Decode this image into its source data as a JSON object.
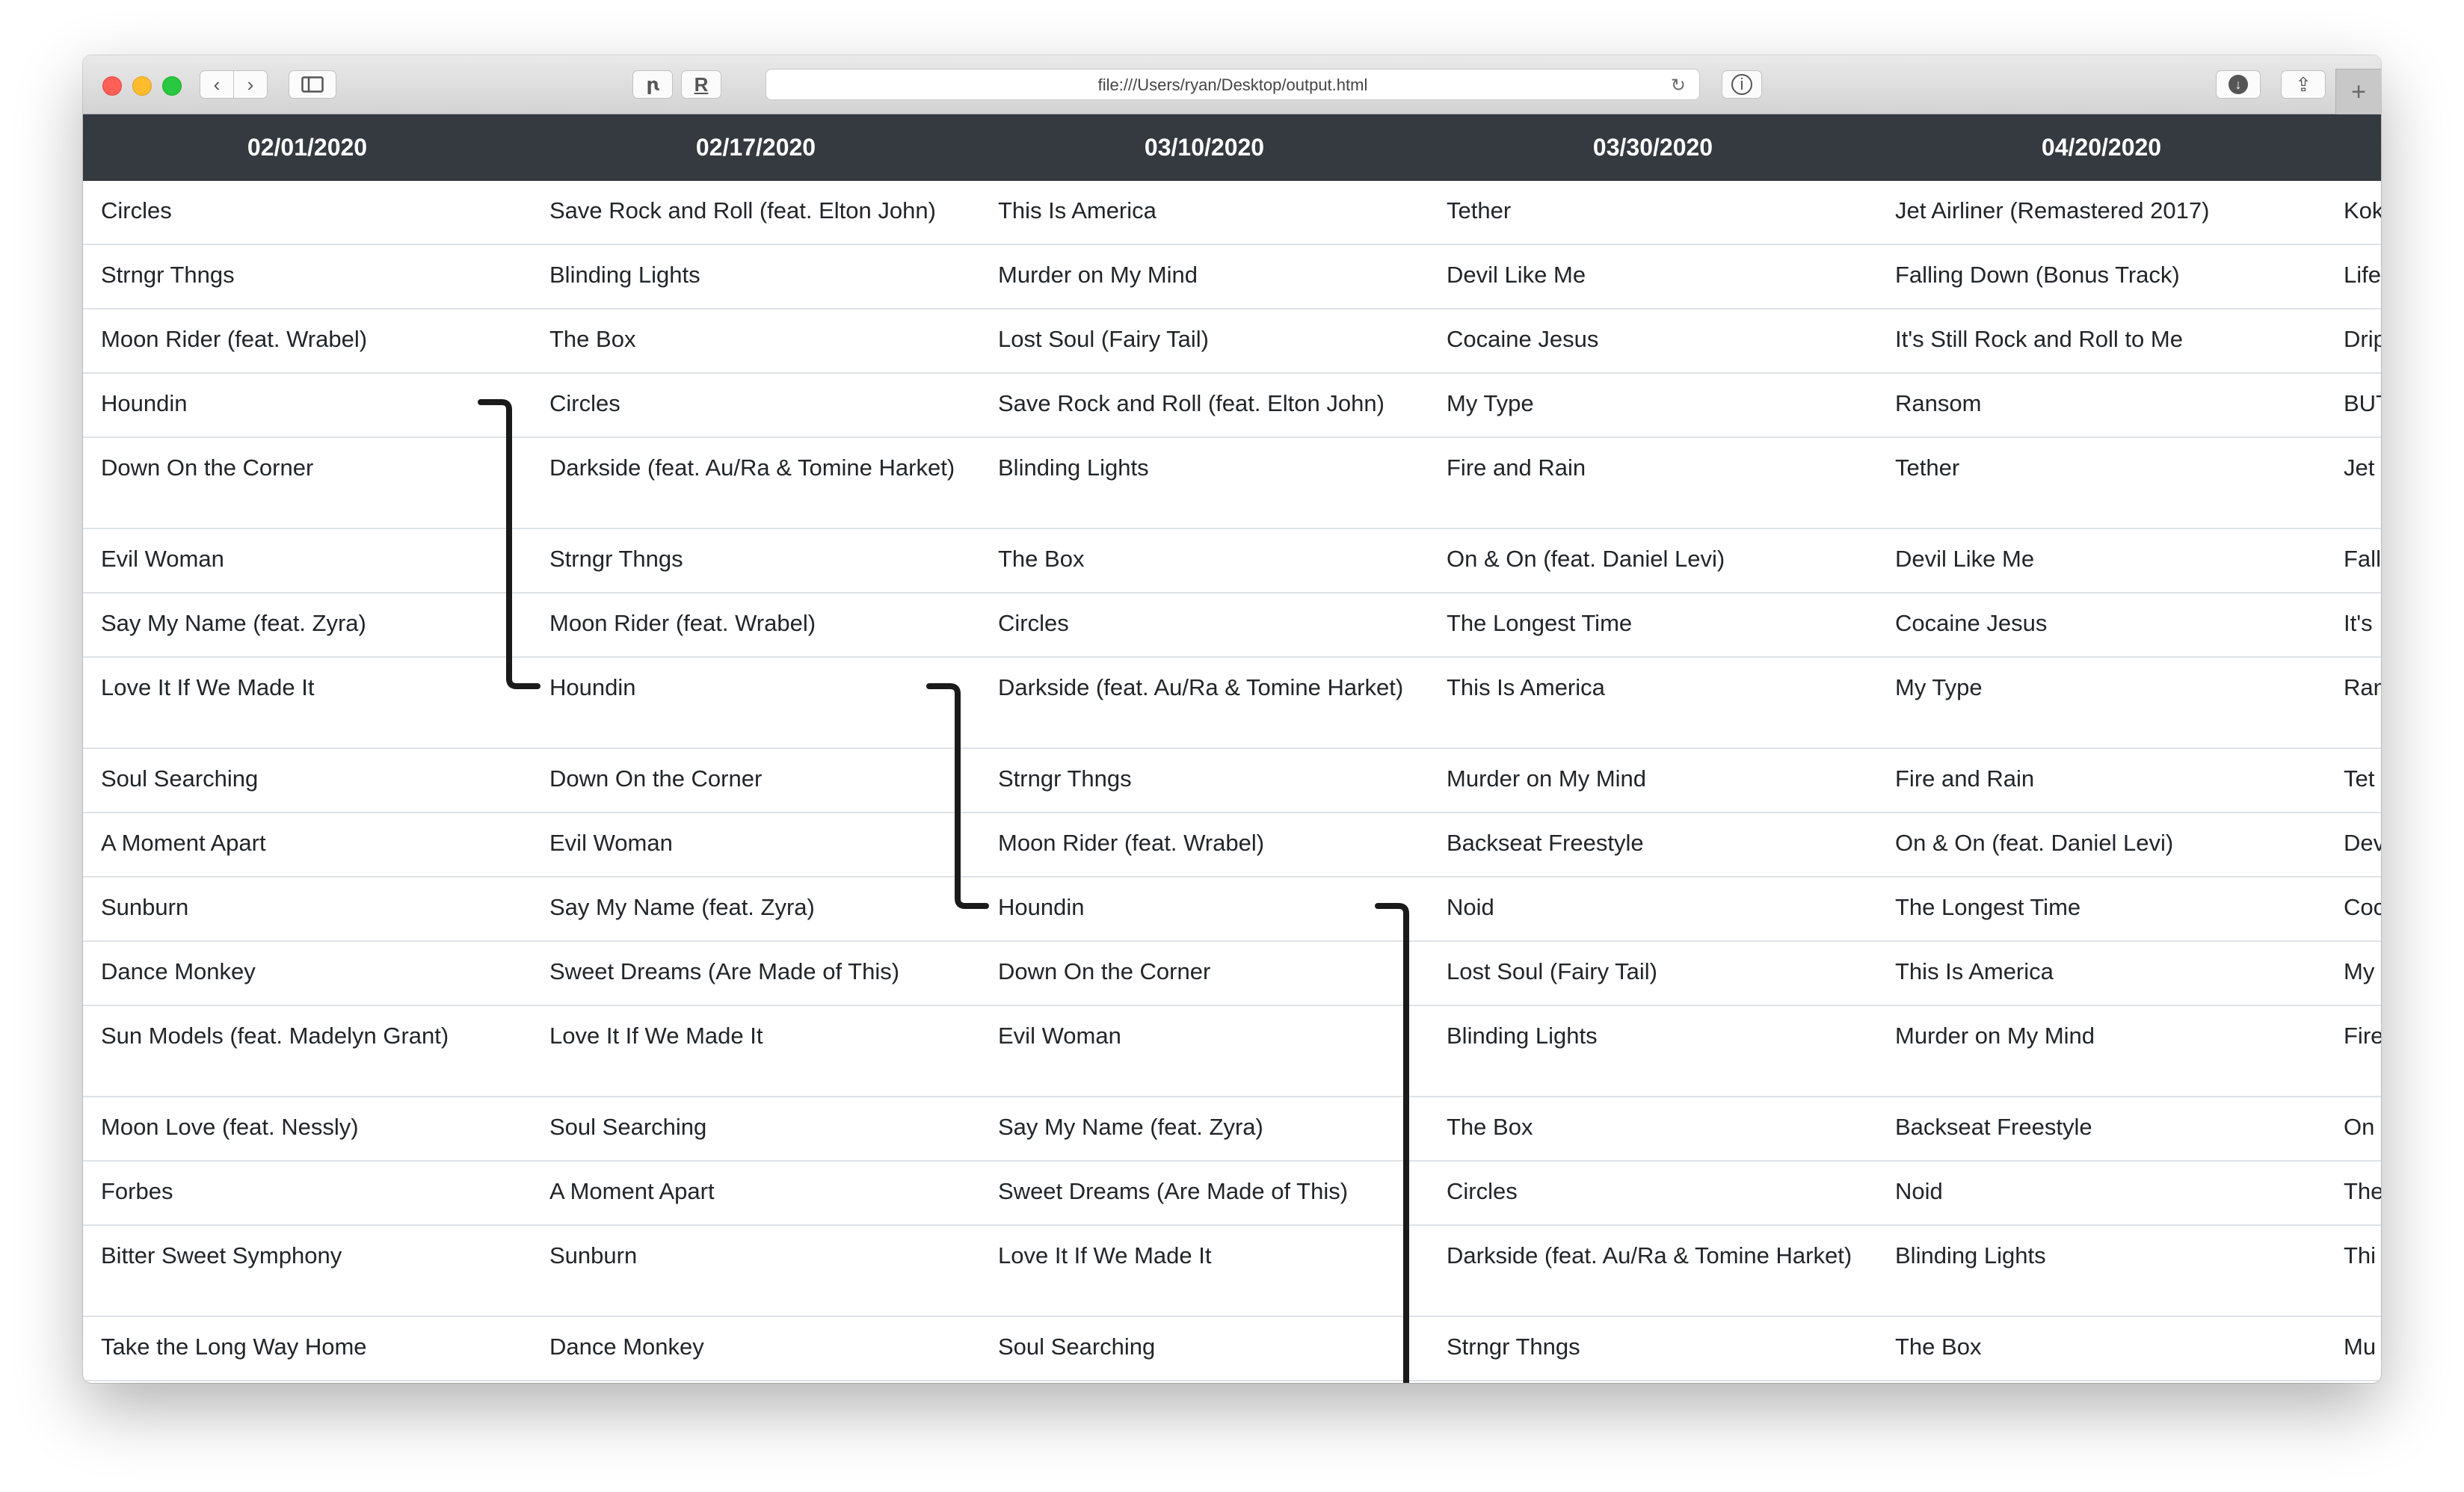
{
  "browser": {
    "url": "file:///Users/ryan/Desktop/output.html",
    "toolbar_icons": [
      "back-icon",
      "forward-icon",
      "sidebar-icon",
      "extension-icon",
      "reader-icon",
      "reload-icon",
      "info-icon",
      "download-icon",
      "share-icon",
      "new-tab-icon"
    ]
  },
  "table": {
    "headers": [
      "02/01/2020",
      "02/17/2020",
      "03/10/2020",
      "03/30/2020",
      "04/20/2020",
      ""
    ],
    "rows": [
      [
        "Circles",
        "Save Rock and Roll (feat. Elton John)",
        "This Is America",
        "Tether",
        "Jet Airliner (Remastered 2017)",
        "Kok"
      ],
      [
        "Strngr Thngs",
        "Blinding Lights",
        "Murder on My Mind",
        "Devil Like Me",
        "Falling Down (Bonus Track)",
        "Life"
      ],
      [
        "Moon Rider (feat. Wrabel)",
        "The Box",
        "Lost Soul (Fairy Tail)",
        "Cocaine Jesus",
        "It's Still Rock and Roll to Me",
        "Drip"
      ],
      [
        "Houndin",
        "Circles",
        "Save Rock and Roll (feat. Elton John)",
        "My Type",
        "Ransom",
        "BUT"
      ],
      [
        "Down On the Corner",
        "Darkside (feat. Au/Ra & Tomine Harket)",
        "Blinding Lights",
        "Fire and Rain",
        "Tether",
        "Jet"
      ],
      [
        "Evil Woman",
        "Strngr Thngs",
        "The Box",
        "On & On (feat. Daniel Levi)",
        "Devil Like Me",
        "Fall"
      ],
      [
        "Say My Name (feat. Zyra)",
        "Moon Rider (feat. Wrabel)",
        "Circles",
        "The Longest Time",
        "Cocaine Jesus",
        "It's"
      ],
      [
        "Love It If We Made It",
        "Houndin",
        "Darkside (feat. Au/Ra & Tomine Harket)",
        "This Is America",
        "My Type",
        "Ran"
      ],
      [
        "Soul Searching",
        "Down On the Corner",
        "Strngr Thngs",
        "Murder on My Mind",
        "Fire and Rain",
        "Tet"
      ],
      [
        "A Moment Apart",
        "Evil Woman",
        "Moon Rider (feat. Wrabel)",
        "Backseat Freestyle",
        "On & On (feat. Daniel Levi)",
        "Dev"
      ],
      [
        "Sunburn",
        "Say My Name (feat. Zyra)",
        "Houndin",
        "Noid",
        "The Longest Time",
        "Coc"
      ],
      [
        "Dance Monkey",
        "Sweet Dreams (Are Made of This)",
        "Down On the Corner",
        "Lost Soul (Fairy Tail)",
        "This Is America",
        "My"
      ],
      [
        "Sun Models (feat. Madelyn Grant)",
        "Love It If We Made It",
        "Evil Woman",
        "Blinding Lights",
        "Murder on My Mind",
        "Fire"
      ],
      [
        "Moon Love (feat. Nessly)",
        "Soul Searching",
        "Say My Name (feat. Zyra)",
        "The Box",
        "Backseat Freestyle",
        "On"
      ],
      [
        "Forbes",
        "A Moment Apart",
        "Sweet Dreams (Are Made of This)",
        "Circles",
        "Noid",
        "The"
      ],
      [
        "Bitter Sweet Symphony",
        "Sunburn",
        "Love It If We Made It",
        "Darkside (feat. Au/Ra & Tomine Harket)",
        "Blinding Lights",
        "Thi"
      ],
      [
        "Take the Long Way Home",
        "Dance Monkey",
        "Soul Searching",
        "Strngr Thngs",
        "The Box",
        "Mu"
      ]
    ],
    "connectors": [
      {
        "song": "Houndin",
        "from": {
          "col": 0,
          "row": 3
        },
        "to": {
          "col": 1,
          "row": 7
        }
      },
      {
        "song": "Houndin",
        "from": {
          "col": 1,
          "row": 7
        },
        "to": {
          "col": 2,
          "row": 10
        }
      },
      {
        "song": "Houndin",
        "from": {
          "col": 2,
          "row": 10
        },
        "to": {
          "col": 3,
          "row": 17
        }
      }
    ]
  },
  "colors": {
    "header_bg": "#343a40",
    "header_text": "#ffffff",
    "row_border": "#dee2e6",
    "cell_text": "#212529",
    "connector": "#1a1a1a"
  }
}
